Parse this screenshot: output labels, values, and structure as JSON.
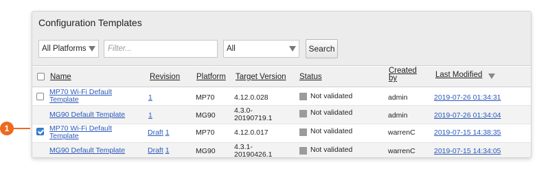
{
  "panel": {
    "title": "Configuration Templates"
  },
  "filters": {
    "platform_select": "All Platforms",
    "filter_placeholder": "Filter...",
    "status_select": "All",
    "search_label": "Search"
  },
  "columns": {
    "name": "Name",
    "revision": "Revision",
    "platform": "Platform",
    "target_version": "Target Version",
    "status": "Status",
    "created_by_1": "Created",
    "created_by_2": "by",
    "last_modified": "Last Modified"
  },
  "rows": [
    {
      "name": "MP70 Wi-Fi Default Template",
      "revision_prefix": "",
      "revision": "1",
      "platform": "MP70",
      "version": "4.12.0.028",
      "status": "Not validated",
      "created_by": "admin",
      "last_modified": "2019-07-26 01:34:31",
      "checked": false
    },
    {
      "name": "MG90 Default Template",
      "revision_prefix": "",
      "revision": "1",
      "platform": "MG90",
      "version": "4.3.0-20190719.1",
      "status": "Not validated",
      "created_by": "admin",
      "last_modified": "2019-07-26 01:34:04",
      "checked": false
    },
    {
      "name": "MP70 Wi-Fi Default Template",
      "revision_prefix": "Draft",
      "revision": "1",
      "platform": "MP70",
      "version": "4.12.0.017",
      "status": "Not validated",
      "created_by": "warrenC",
      "last_modified": "2019-07-15 14:38:35",
      "checked": true
    },
    {
      "name": "MG90 Default Template",
      "revision_prefix": "Draft",
      "revision": "1",
      "platform": "MG90",
      "version": "4.3.1-20190426.1",
      "status": "Not validated",
      "created_by": "warrenC",
      "last_modified": "2019-07-15 14:34:05",
      "checked": false
    }
  ],
  "callout": {
    "number": "1"
  },
  "colors": {
    "callout": "#ee6a1f",
    "link": "#2a58b8",
    "check": "#3b82d6"
  }
}
